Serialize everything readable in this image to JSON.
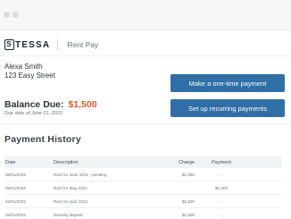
{
  "brand": {
    "logo_text": "TESSA",
    "logo_letter": "S",
    "app_name": "Rent Pay"
  },
  "customer": {
    "name": "Alexa Smith",
    "address": "123 Easy Street"
  },
  "balance": {
    "label": "Balance Due:",
    "amount": "$1,500",
    "due_note": "Due date of June 01, 2022"
  },
  "actions": {
    "one_time": "Make a one-time payment",
    "recurring": "Set up recurring payments"
  },
  "history": {
    "title": "Payment History",
    "columns": {
      "date": "Date",
      "description": "Description",
      "charge": "Charge",
      "payment": "Payment"
    },
    "rows": [
      {
        "date": "06/01/2022",
        "description": "Rent for June 2022 - pending",
        "charge": "$1,500",
        "payment": "..."
      },
      {
        "date": "05/01/2022",
        "description": "Rent for May 2022",
        "charge": "",
        "payment": "$1,500"
      },
      {
        "date": "04/01/2022",
        "description": "Rent for April 2022",
        "charge": "$1,500",
        "payment": "..."
      },
      {
        "date": "04/01/2022",
        "description": "Security deposit",
        "charge": "$1,500",
        "payment": "..."
      }
    ]
  }
}
